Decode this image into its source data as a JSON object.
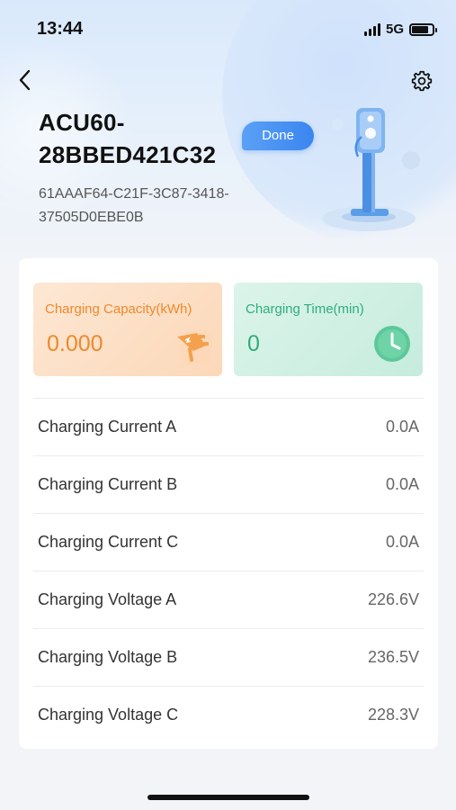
{
  "status_bar": {
    "time": "13:44",
    "network": "5G",
    "battery_level": 0.8
  },
  "header": {
    "back_icon": "chevron-left-icon",
    "settings_icon": "gear-icon",
    "device_name": "ACU60-28BBED421C32",
    "status_badge": "Done",
    "device_uuid": "61AAAF64-C21F-3C87-3418-37505D0EBE0B",
    "illustration": "ev-charger-icon"
  },
  "stats": {
    "capacity": {
      "label": "Charging Capacity(kWh)",
      "value": "0.000",
      "icon": "charging-plug-icon"
    },
    "time": {
      "label": "Charging Time(min)",
      "value": "0",
      "icon": "clock-icon"
    }
  },
  "rows": [
    {
      "label": "Charging Current A",
      "value": "0.0A"
    },
    {
      "label": "Charging Current B",
      "value": "0.0A"
    },
    {
      "label": "Charging Current C",
      "value": "0.0A"
    },
    {
      "label": "Charging Voltage A",
      "value": "226.6V"
    },
    {
      "label": "Charging Voltage B",
      "value": "236.5V"
    },
    {
      "label": "Charging Voltage C",
      "value": "228.3V"
    }
  ],
  "colors": {
    "accent": "#3a86f0",
    "capacity": "#ec8a2c",
    "time": "#2fae7d"
  }
}
